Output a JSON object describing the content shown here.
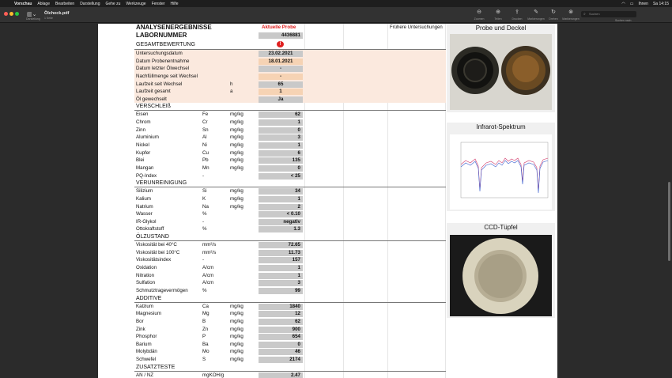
{
  "menubar": {
    "app": "Vorschau",
    "items": [
      "Ablage",
      "Bearbeiten",
      "Darstellung",
      "Gehe zu",
      "Werkzeuge",
      "Fenster",
      "Hilfe"
    ],
    "status": [
      "Ihnen",
      "Sa 14:15"
    ]
  },
  "toolbar": {
    "sidebar_label": "Darstellung",
    "doc_title": "Ölcheck.pdf",
    "doc_subtitle": "1 Seite",
    "tools": [
      {
        "icon": "zoom-out-icon",
        "glyph": "⊖",
        "label": "Zoomen"
      },
      {
        "icon": "zoom-in-icon",
        "glyph": "⊕",
        "label": "Teilen"
      },
      {
        "icon": "share-icon",
        "glyph": "⇪",
        "label": "Drucken"
      },
      {
        "icon": "pen-icon",
        "glyph": "✎",
        "label": "Markierungen"
      },
      {
        "icon": "rotate-icon",
        "glyph": "↻",
        "label": "Drehen"
      },
      {
        "icon": "markup-icon",
        "glyph": "⊗",
        "label": "Markierungen"
      }
    ],
    "search_placeholder": "Suchen",
    "search_label": "Suchen nach"
  },
  "report": {
    "header_left": "ANALYSENERGEBNISSE",
    "header_current": "Aktuelle Probe",
    "header_previous": "Frühere Untersuchungen",
    "lab_label": "LABORNUMMER",
    "lab_value": "4436881",
    "assessment_label": "GESAMTBEWERTUNG",
    "assessment_flag": "!",
    "info_rows": [
      {
        "label": "Untersuchungsdatum",
        "unit": "",
        "value": "23.02.2021",
        "style": "val"
      },
      {
        "label": "Datum Probenentnahme",
        "unit": "",
        "value": "18.01.2021",
        "style": "peach"
      },
      {
        "label": "Datum letzter Ölwechsel",
        "unit": "",
        "value": "-",
        "style": "val"
      },
      {
        "label": "Nachfüllmenge seit Wechsel",
        "unit": "",
        "value": "-",
        "style": "peach"
      },
      {
        "label": "Laufzeit seit Wechsel",
        "unit": "h",
        "value": "65",
        "style": "val"
      },
      {
        "label": "Laufzeit gesamt",
        "unit": "a",
        "value": "1",
        "style": "peach"
      },
      {
        "label": "Öl gewechselt",
        "unit": "",
        "value": "Ja",
        "style": "val"
      }
    ],
    "sections": [
      {
        "title": "VERSCHLEIß",
        "rows": [
          {
            "name": "Eisen",
            "symbol": "Fe",
            "unit": "mg/kg",
            "value": "62"
          },
          {
            "name": "Chrom",
            "symbol": "Cr",
            "unit": "mg/kg",
            "value": "1"
          },
          {
            "name": "Zinn",
            "symbol": "Sn",
            "unit": "mg/kg",
            "value": "0"
          },
          {
            "name": "Aluminium",
            "symbol": "Al",
            "unit": "mg/kg",
            "value": "3"
          },
          {
            "name": "Nickel",
            "symbol": "Ni",
            "unit": "mg/kg",
            "value": "1"
          },
          {
            "name": "Kupfer",
            "symbol": "Cu",
            "unit": "mg/kg",
            "value": "6"
          },
          {
            "name": "Blei",
            "symbol": "Pb",
            "unit": "mg/kg",
            "value": "135"
          },
          {
            "name": "Mangan",
            "symbol": "Mn",
            "unit": "mg/kg",
            "value": "0"
          },
          {
            "name": "PQ-Index",
            "symbol": "-",
            "unit": "",
            "value": "< 25"
          }
        ]
      },
      {
        "title": "VERUNREINIGUNG",
        "rows": [
          {
            "name": "Silizium",
            "symbol": "Si",
            "unit": "mg/kg",
            "value": "34"
          },
          {
            "name": "Kalium",
            "symbol": "K",
            "unit": "mg/kg",
            "value": "1"
          },
          {
            "name": "Natrium",
            "symbol": "Na",
            "unit": "mg/kg",
            "value": "2"
          },
          {
            "name": "Wasser",
            "symbol": "%",
            "unit": "",
            "value": "< 0.10"
          },
          {
            "name": "IR-Glykol",
            "symbol": "-",
            "unit": "",
            "value": "negativ"
          },
          {
            "name": "Ottokraftstoff",
            "symbol": "%",
            "unit": "",
            "value": "1.3"
          }
        ]
      },
      {
        "title": "ÖLZUSTAND",
        "rows": [
          {
            "name": "Viskosität bei 40°C",
            "symbol": "mm²/s",
            "unit": "",
            "value": "72.65"
          },
          {
            "name": "Viskosität bei 100°C",
            "symbol": "mm²/s",
            "unit": "",
            "value": "11.73"
          },
          {
            "name": "Viskositätsindex",
            "symbol": "-",
            "unit": "",
            "value": "157"
          },
          {
            "name": "Oxidation",
            "symbol": "A/cm",
            "unit": "",
            "value": "1"
          },
          {
            "name": "Nitration",
            "symbol": "A/cm",
            "unit": "",
            "value": "1"
          },
          {
            "name": "Sulfation",
            "symbol": "A/cm",
            "unit": "",
            "value": "3"
          },
          {
            "name": "Schmutztragevermögen",
            "symbol": "%",
            "unit": "",
            "value": "99"
          }
        ]
      },
      {
        "title": "ADDITIVE",
        "rows": [
          {
            "name": "Kalzium",
            "symbol": "Ca",
            "unit": "mg/kg",
            "value": "1840"
          },
          {
            "name": "Magnesium",
            "symbol": "Mg",
            "unit": "mg/kg",
            "value": "12"
          },
          {
            "name": "Bor",
            "symbol": "B",
            "unit": "mg/kg",
            "value": "62"
          },
          {
            "name": "Zink",
            "symbol": "Zn",
            "unit": "mg/kg",
            "value": "900"
          },
          {
            "name": "Phosphor",
            "symbol": "P",
            "unit": "mg/kg",
            "value": "654"
          },
          {
            "name": "Barium",
            "symbol": "Ba",
            "unit": "mg/kg",
            "value": "0"
          },
          {
            "name": "Molybdän",
            "symbol": "Mo",
            "unit": "mg/kg",
            "value": "46"
          },
          {
            "name": "Schwefel",
            "symbol": "S",
            "unit": "mg/kg",
            "value": "2174"
          }
        ]
      },
      {
        "title": "ZUSATZTESTE",
        "rows": [
          {
            "name": "AN / NZ",
            "symbol": "mgKOH/g",
            "unit": "",
            "value": "2.47"
          }
        ]
      }
    ]
  },
  "panels": {
    "sample": "Probe und Deckel",
    "ir": "Infrarot-Spektrum",
    "ccd": "CCD-Tüpfel"
  },
  "colors": {
    "accent_red": "#e02020",
    "value_gray": "#c9c9c9",
    "value_peach": "#f6d3b4",
    "row_highlight": "#fbe9de"
  }
}
